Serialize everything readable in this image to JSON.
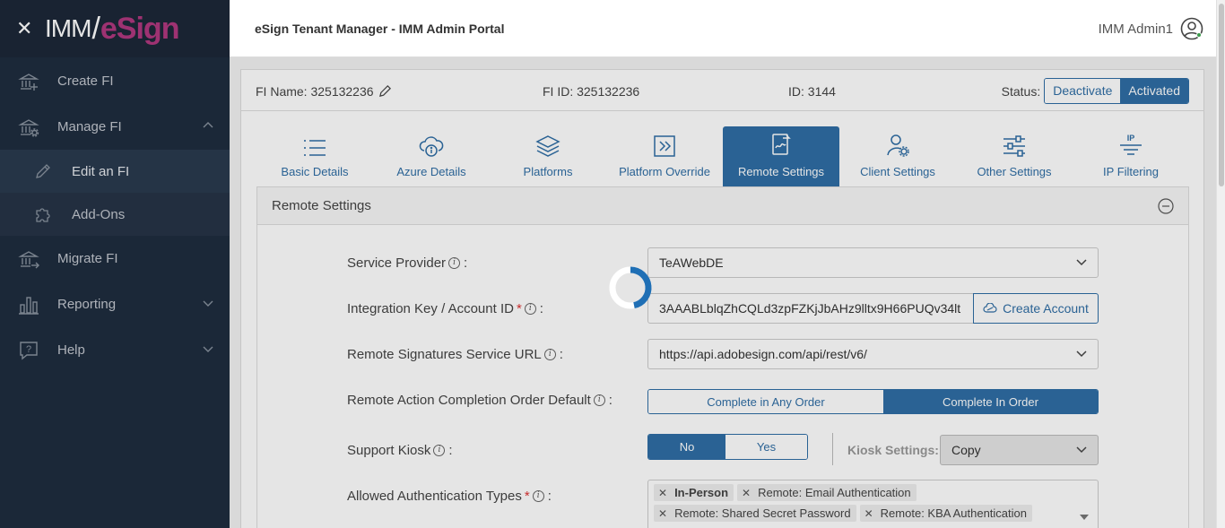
{
  "header": {
    "title": "eSign Tenant Manager - IMM Admin Portal",
    "user_name": "IMM Admin1"
  },
  "logo": {
    "part1": "IMM",
    "part2": "eSign"
  },
  "sidebar": {
    "items": [
      {
        "label": "Create FI",
        "icon": "bank-plus-icon"
      },
      {
        "label": "Manage FI",
        "icon": "bank-gear-icon",
        "expanded": true
      },
      {
        "label": "Edit an FI",
        "icon": "pencil-icon",
        "sub": true
      },
      {
        "label": "Add-Ons",
        "icon": "puzzle-icon",
        "sub": true
      },
      {
        "label": "Migrate FI",
        "icon": "bank-arrow-icon"
      },
      {
        "label": "Reporting",
        "icon": "bar-chart-icon"
      },
      {
        "label": "Help",
        "icon": "question-icon"
      }
    ]
  },
  "info": {
    "fi_name": "FI Name: 325132236",
    "fi_id": "FI ID: 325132236",
    "id": "ID: 3144",
    "status_label": "Status:",
    "deactivate": "Deactivate",
    "activated": "Activated"
  },
  "tabs": [
    {
      "label": "Basic Details"
    },
    {
      "label": "Azure Details"
    },
    {
      "label": "Platforms"
    },
    {
      "label": "Platform Override"
    },
    {
      "label": "Remote Settings",
      "active": true
    },
    {
      "label": "Client Settings"
    },
    {
      "label": "Other Settings"
    },
    {
      "label": "IP Filtering"
    }
  ],
  "panel": {
    "title": "Remote Settings",
    "fields": {
      "service_provider_label": "Service Provider",
      "service_provider_value": "TeAWebDE",
      "integration_key_label": "Integration Key / Account ID",
      "integration_key_value": "3AAABLblqZhCQLd3zpFZKjJbAHz9lltx9H66PUQv34lt",
      "create_account": "Create Account",
      "service_url_label": "Remote Signatures Service URL",
      "service_url_value": "https://api.adobesign.com/api/rest/v6/",
      "completion_order_label": "Remote Action Completion Order Default",
      "complete_any": "Complete in Any Order",
      "complete_in": "Complete In Order",
      "kiosk_label": "Support Kiosk",
      "kiosk_no": "No",
      "kiosk_yes": "Yes",
      "kiosk_settings_label": "Kiosk Settings:",
      "kiosk_settings_value": "Copy",
      "auth_types_label": "Allowed Authentication Types",
      "auth_tags": [
        "In-Person",
        "Remote: Email Authentication",
        "Remote: Shared Secret Password",
        "Remote: KBA Authentication"
      ]
    }
  },
  "colors": {
    "accent": "#2f6ea5",
    "sidebar": "#1f2d3f",
    "brand": "#b0387f"
  }
}
